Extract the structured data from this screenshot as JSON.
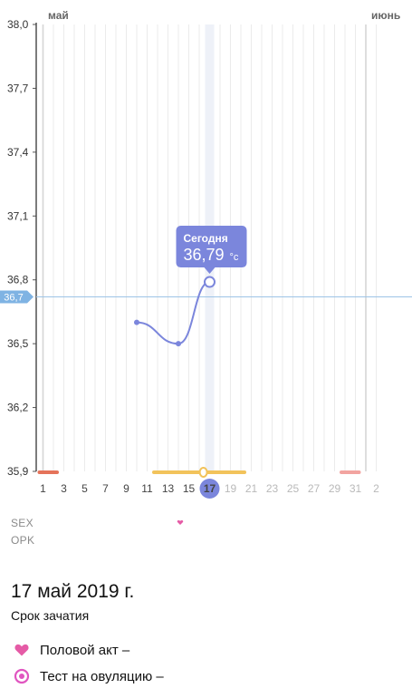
{
  "chart_data": {
    "type": "line",
    "title": "",
    "xlabel": "",
    "ylabel": "",
    "y_ticks": [
      "38,0",
      "37,7",
      "37,4",
      "37,1",
      "36,8",
      "36,5",
      "36,2",
      "35,9"
    ],
    "ylim": [
      35.9,
      38.0
    ],
    "x_tick_labels": [
      "1",
      "3",
      "5",
      "7",
      "9",
      "11",
      "13",
      "15",
      "17",
      "19",
      "21",
      "23",
      "25",
      "27",
      "29",
      "31",
      "2"
    ],
    "months": [
      "май",
      "июнь"
    ],
    "coverline": {
      "label": "36,7",
      "value": 36.72
    },
    "series": [
      {
        "values_by_day": [
          {
            "day": 10,
            "value": 36.6
          },
          {
            "day": 14,
            "value": 36.5
          },
          {
            "day": 17,
            "value": 36.79
          }
        ],
        "color": "#7b86dc"
      }
    ],
    "today": {
      "day": 17,
      "label": "Сегодня",
      "value": "36,79",
      "unit": "°c"
    },
    "phases": [
      {
        "type": "menstruation",
        "from_day": 1,
        "to_day": 2,
        "color": "#e5735a"
      },
      {
        "type": "fertile",
        "from_day": 12,
        "to_day": 20,
        "color": "#f2c35b"
      },
      {
        "type": "ovulation",
        "day": 16,
        "color": "#f2c35b"
      },
      {
        "type": "menstruation-predicted",
        "from_day": 30,
        "to_day": 31,
        "color": "#f2a4a0"
      }
    ],
    "grid": true
  },
  "rows": {
    "sex_label": "SEX",
    "opk_label": "OPK",
    "sex_marks": [
      {
        "day": 14
      }
    ]
  },
  "details": {
    "date": "17 май 2019 г.",
    "phase": "Срок зачатия"
  },
  "legend": [
    {
      "icon": "heart-icon",
      "label": "Половой акт",
      "value": "–",
      "color": "#e55ba6"
    },
    {
      "icon": "ovulation-test-icon",
      "label": "Тест на овуляцию",
      "value": "–",
      "color": "#e055c0"
    }
  ],
  "colors": {
    "accent": "#7b86dc",
    "today_bubble": "#7b86dc",
    "coverline": "#9dc4e6",
    "grid": "#e3e3e3"
  }
}
